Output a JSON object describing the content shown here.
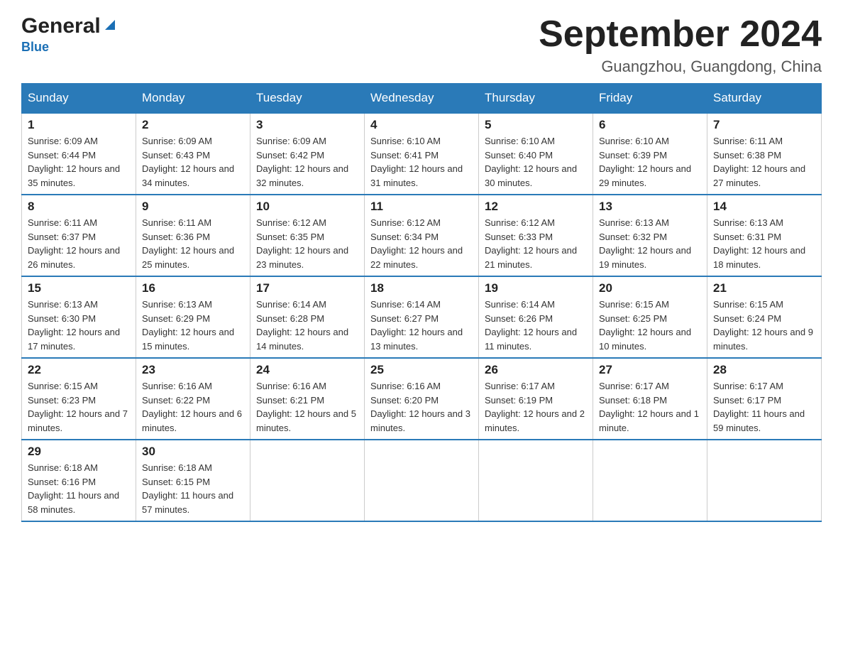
{
  "header": {
    "logo_general": "General",
    "logo_blue": "Blue",
    "month_year": "September 2024",
    "location": "Guangzhou, Guangdong, China"
  },
  "weekdays": [
    "Sunday",
    "Monday",
    "Tuesday",
    "Wednesday",
    "Thursday",
    "Friday",
    "Saturday"
  ],
  "weeks": [
    [
      {
        "day": "1",
        "sunrise": "6:09 AM",
        "sunset": "6:44 PM",
        "daylight": "12 hours and 35 minutes."
      },
      {
        "day": "2",
        "sunrise": "6:09 AM",
        "sunset": "6:43 PM",
        "daylight": "12 hours and 34 minutes."
      },
      {
        "day": "3",
        "sunrise": "6:09 AM",
        "sunset": "6:42 PM",
        "daylight": "12 hours and 32 minutes."
      },
      {
        "day": "4",
        "sunrise": "6:10 AM",
        "sunset": "6:41 PM",
        "daylight": "12 hours and 31 minutes."
      },
      {
        "day": "5",
        "sunrise": "6:10 AM",
        "sunset": "6:40 PM",
        "daylight": "12 hours and 30 minutes."
      },
      {
        "day": "6",
        "sunrise": "6:10 AM",
        "sunset": "6:39 PM",
        "daylight": "12 hours and 29 minutes."
      },
      {
        "day": "7",
        "sunrise": "6:11 AM",
        "sunset": "6:38 PM",
        "daylight": "12 hours and 27 minutes."
      }
    ],
    [
      {
        "day": "8",
        "sunrise": "6:11 AM",
        "sunset": "6:37 PM",
        "daylight": "12 hours and 26 minutes."
      },
      {
        "day": "9",
        "sunrise": "6:11 AM",
        "sunset": "6:36 PM",
        "daylight": "12 hours and 25 minutes."
      },
      {
        "day": "10",
        "sunrise": "6:12 AM",
        "sunset": "6:35 PM",
        "daylight": "12 hours and 23 minutes."
      },
      {
        "day": "11",
        "sunrise": "6:12 AM",
        "sunset": "6:34 PM",
        "daylight": "12 hours and 22 minutes."
      },
      {
        "day": "12",
        "sunrise": "6:12 AM",
        "sunset": "6:33 PM",
        "daylight": "12 hours and 21 minutes."
      },
      {
        "day": "13",
        "sunrise": "6:13 AM",
        "sunset": "6:32 PM",
        "daylight": "12 hours and 19 minutes."
      },
      {
        "day": "14",
        "sunrise": "6:13 AM",
        "sunset": "6:31 PM",
        "daylight": "12 hours and 18 minutes."
      }
    ],
    [
      {
        "day": "15",
        "sunrise": "6:13 AM",
        "sunset": "6:30 PM",
        "daylight": "12 hours and 17 minutes."
      },
      {
        "day": "16",
        "sunrise": "6:13 AM",
        "sunset": "6:29 PM",
        "daylight": "12 hours and 15 minutes."
      },
      {
        "day": "17",
        "sunrise": "6:14 AM",
        "sunset": "6:28 PM",
        "daylight": "12 hours and 14 minutes."
      },
      {
        "day": "18",
        "sunrise": "6:14 AM",
        "sunset": "6:27 PM",
        "daylight": "12 hours and 13 minutes."
      },
      {
        "day": "19",
        "sunrise": "6:14 AM",
        "sunset": "6:26 PM",
        "daylight": "12 hours and 11 minutes."
      },
      {
        "day": "20",
        "sunrise": "6:15 AM",
        "sunset": "6:25 PM",
        "daylight": "12 hours and 10 minutes."
      },
      {
        "day": "21",
        "sunrise": "6:15 AM",
        "sunset": "6:24 PM",
        "daylight": "12 hours and 9 minutes."
      }
    ],
    [
      {
        "day": "22",
        "sunrise": "6:15 AM",
        "sunset": "6:23 PM",
        "daylight": "12 hours and 7 minutes."
      },
      {
        "day": "23",
        "sunrise": "6:16 AM",
        "sunset": "6:22 PM",
        "daylight": "12 hours and 6 minutes."
      },
      {
        "day": "24",
        "sunrise": "6:16 AM",
        "sunset": "6:21 PM",
        "daylight": "12 hours and 5 minutes."
      },
      {
        "day": "25",
        "sunrise": "6:16 AM",
        "sunset": "6:20 PM",
        "daylight": "12 hours and 3 minutes."
      },
      {
        "day": "26",
        "sunrise": "6:17 AM",
        "sunset": "6:19 PM",
        "daylight": "12 hours and 2 minutes."
      },
      {
        "day": "27",
        "sunrise": "6:17 AM",
        "sunset": "6:18 PM",
        "daylight": "12 hours and 1 minute."
      },
      {
        "day": "28",
        "sunrise": "6:17 AM",
        "sunset": "6:17 PM",
        "daylight": "11 hours and 59 minutes."
      }
    ],
    [
      {
        "day": "29",
        "sunrise": "6:18 AM",
        "sunset": "6:16 PM",
        "daylight": "11 hours and 58 minutes."
      },
      {
        "day": "30",
        "sunrise": "6:18 AM",
        "sunset": "6:15 PM",
        "daylight": "11 hours and 57 minutes."
      },
      null,
      null,
      null,
      null,
      null
    ]
  ]
}
